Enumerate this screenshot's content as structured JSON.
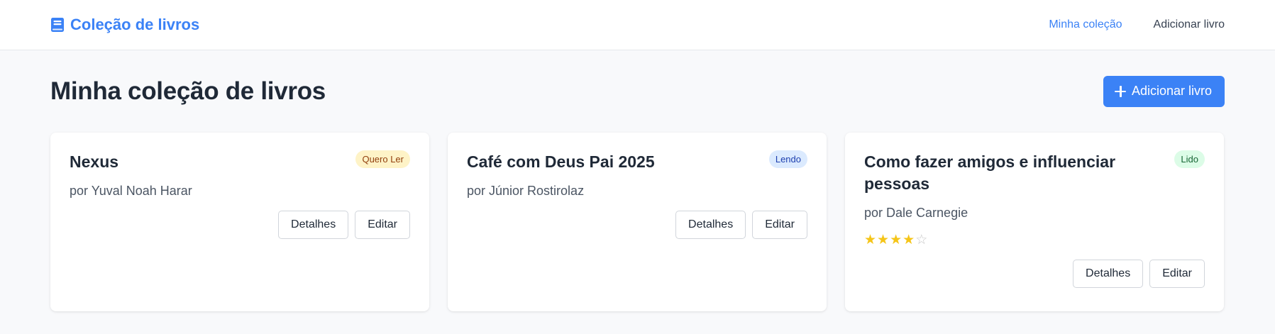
{
  "header": {
    "brand": "Coleção de livros",
    "brand_icon": "book-icon",
    "nav": [
      {
        "label": "Minha coleção",
        "active": true
      },
      {
        "label": "Adicionar livro",
        "active": false
      }
    ]
  },
  "page": {
    "title": "Minha coleção de livros",
    "add_button": "Adicionar livro",
    "add_icon": "plus-icon"
  },
  "books": [
    {
      "title": "Nexus",
      "author": "por Yuval Noah Harar",
      "status": "Quero Ler",
      "status_color": "#fef3c7",
      "details_label": "Detalhes",
      "edit_label": "Editar"
    },
    {
      "title": "Café com Deus Pai 2025",
      "author": "por Júnior Rostirolaz",
      "status": "Lendo",
      "status_color": "#dbeafe",
      "details_label": "Detalhes",
      "edit_label": "Editar"
    },
    {
      "title": "Como fazer amigos e influenciar pessoas",
      "author": "por Dale Carnegie",
      "status": "Lido",
      "status_color": "#dcfce7",
      "rating": 4,
      "rating_max": 5,
      "details_label": "Detalhes",
      "edit_label": "Editar"
    }
  ],
  "colors": {
    "accent": "#3b82f6",
    "background": "#f8f9fb",
    "star": "#f5c518"
  }
}
